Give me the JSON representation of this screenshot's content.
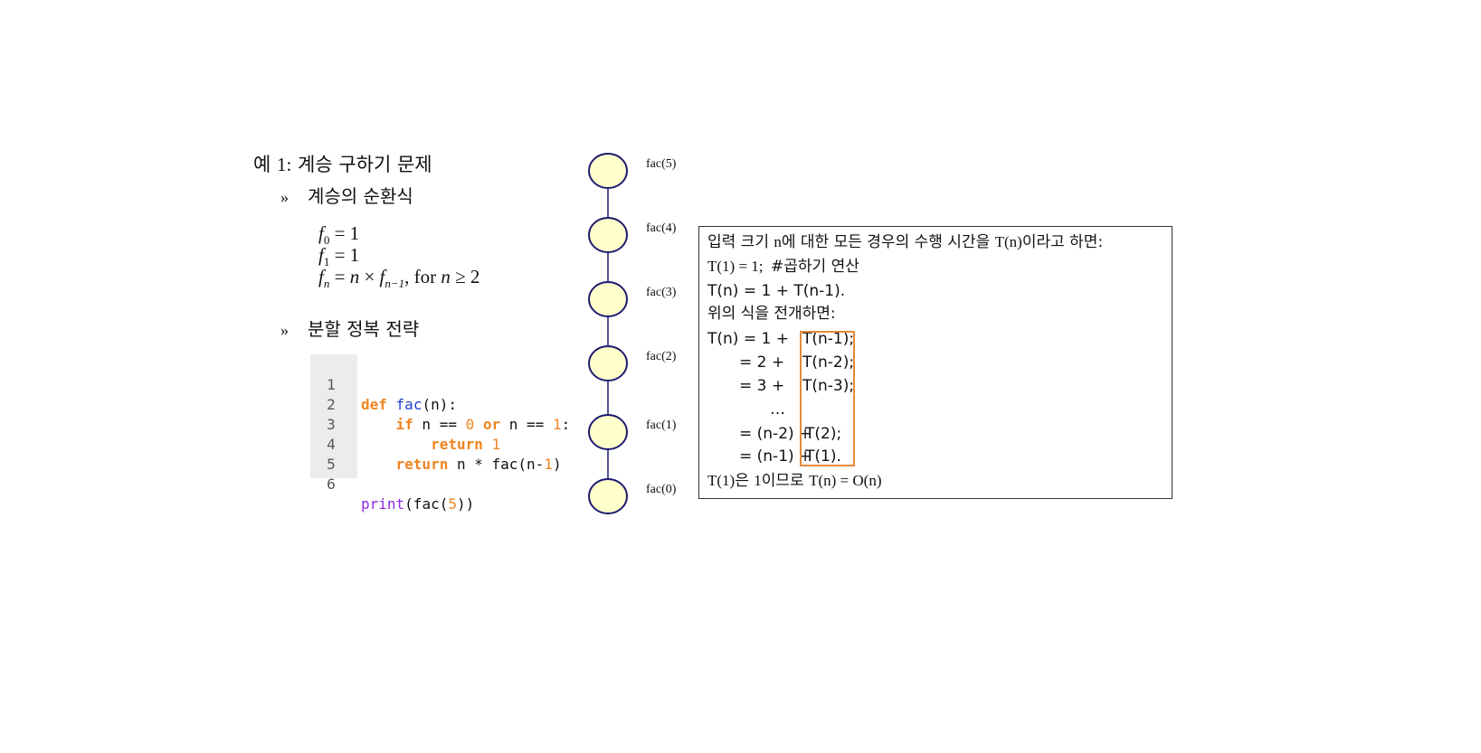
{
  "title": {
    "prefix": "예 ",
    "num": "1:",
    "text": " 계승 구하기  문제"
  },
  "bullet1": {
    "mark": "»",
    "text": "계승의 순환식"
  },
  "formulas": [
    {
      "f": "f",
      "sub": "0",
      "rest": " = 1"
    },
    {
      "f": "f",
      "sub": "1",
      "rest": " = 1"
    },
    {
      "f": "f",
      "sub": "n",
      "rest1": " = ",
      "n": "n",
      "times": " × ",
      "f2": "f",
      "sub2": "n−1",
      "rest2": ", for ",
      "n2": "n",
      "rest3": " ≥ 2"
    }
  ],
  "bullet2": {
    "mark": "»",
    "text": "분할 정복 전략"
  },
  "code": {
    "line_numbers": [
      "1",
      "2",
      "3",
      "4",
      "5",
      "6"
    ],
    "l1": {
      "def": "def",
      "sp": " ",
      "name": "fac",
      "rest": "(n):"
    },
    "l2": {
      "indent": "    ",
      "if": "if",
      "a": " n == ",
      "zero": "0",
      "sp": " ",
      "or": "or",
      "b": " n == ",
      "one": "1",
      "colon": ":"
    },
    "l3": {
      "indent": "        ",
      "ret": "return",
      "sp": " ",
      "one": "1"
    },
    "l4": {
      "indent": "    ",
      "ret": "return",
      "a": " n * fac(n-",
      "one": "1",
      "b": ")"
    },
    "l6": {
      "print": "print",
      "a": "(fac(",
      "five": "5",
      "b": "))"
    }
  },
  "tree": {
    "labels": [
      "fac(5)",
      "fac(4)",
      "fac(3)",
      "fac(2)",
      "fac(1)",
      "fac(0)"
    ],
    "node_fill": "#ffffcc",
    "node_stroke": "#1a1a6e"
  },
  "box": {
    "l1": {
      "a": "입력 크기 ",
      "b": "n",
      "c": "에 대한 모든 경우의 수행 시간을 ",
      "d": "T(n)",
      "e": "이라고 하면:"
    },
    "l2": {
      "a": "T(1) = 1;  ",
      "b": "#곱하기 연산"
    },
    "l3": "T(n) = 1 + T(n-1).",
    "l4": "위의 식을 전개하면:",
    "l5": {
      "a": "T(n) = 1 +",
      "b": "T(n-1);"
    },
    "l6": {
      "a": "= 2 +",
      "b": "T(n-2);"
    },
    "l7": {
      "a": "= 3 +",
      "b": "T(n-3);"
    },
    "l8": "…",
    "l9": {
      "a": "= (n-2) + ",
      "b": "T(2);"
    },
    "l10": {
      "a": "= (n-1) + ",
      "b": "T(1)."
    },
    "l11": {
      "a": "T(1)",
      "b": "은 ",
      "c": "1",
      "d": "이므로 ",
      "e": "T(n) = O(n)"
    }
  },
  "highlight_color": "#e8893a"
}
